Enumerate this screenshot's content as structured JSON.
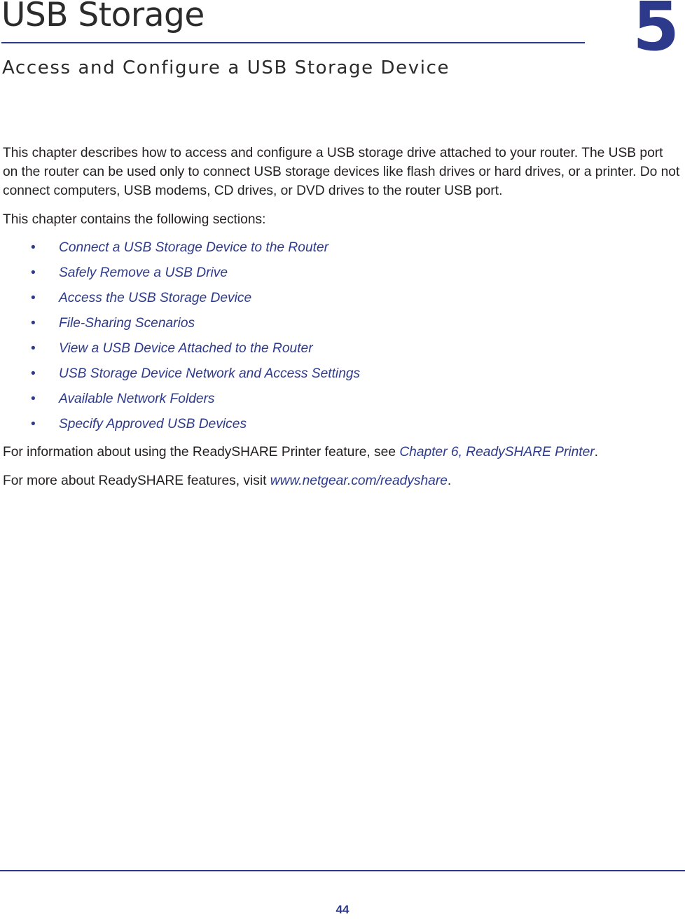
{
  "header": {
    "chapter_title": "USB Storage",
    "chapter_subtitle": "Access and Configure a USB Storage Device",
    "chapter_number": "5",
    "rule_color": "#2d3a8c",
    "title_color": "#2b2b2b",
    "accent_color": "#2d3a8c"
  },
  "body": {
    "intro_paragraph": "This chapter describes how to access and configure a USB storage drive attached to your router. The USB port on the router can be used only to connect USB storage devices like flash drives or hard drives, or a printer. Do not connect computers, USB modems, CD drives, or DVD drives to the router USB port.",
    "sections_lead": "This chapter contains the following sections:",
    "bullet_glyph": "•",
    "sections": [
      {
        "label": "Connect a USB Storage Device to the Router"
      },
      {
        "label": "Safely Remove a USB Drive"
      },
      {
        "label": "Access the USB Storage Device"
      },
      {
        "label": "File-Sharing Scenarios"
      },
      {
        "label": "View a USB Device Attached to the Router"
      },
      {
        "label": "USB Storage Device Network and Access Settings"
      },
      {
        "label": "Available Network Folders"
      },
      {
        "label": "Specify Approved USB Devices"
      }
    ],
    "printer_para_prefix": "For information about using the ReadySHARE Printer feature, see ",
    "printer_para_link": "Chapter 6, ReadySHARE Printer",
    "printer_para_suffix": ".",
    "readyshare_para_prefix": "For more about ReadySHARE features, visit ",
    "readyshare_para_link": "www.netgear.com/readyshare",
    "readyshare_para_suffix": "."
  },
  "footer": {
    "page_number": "44"
  }
}
